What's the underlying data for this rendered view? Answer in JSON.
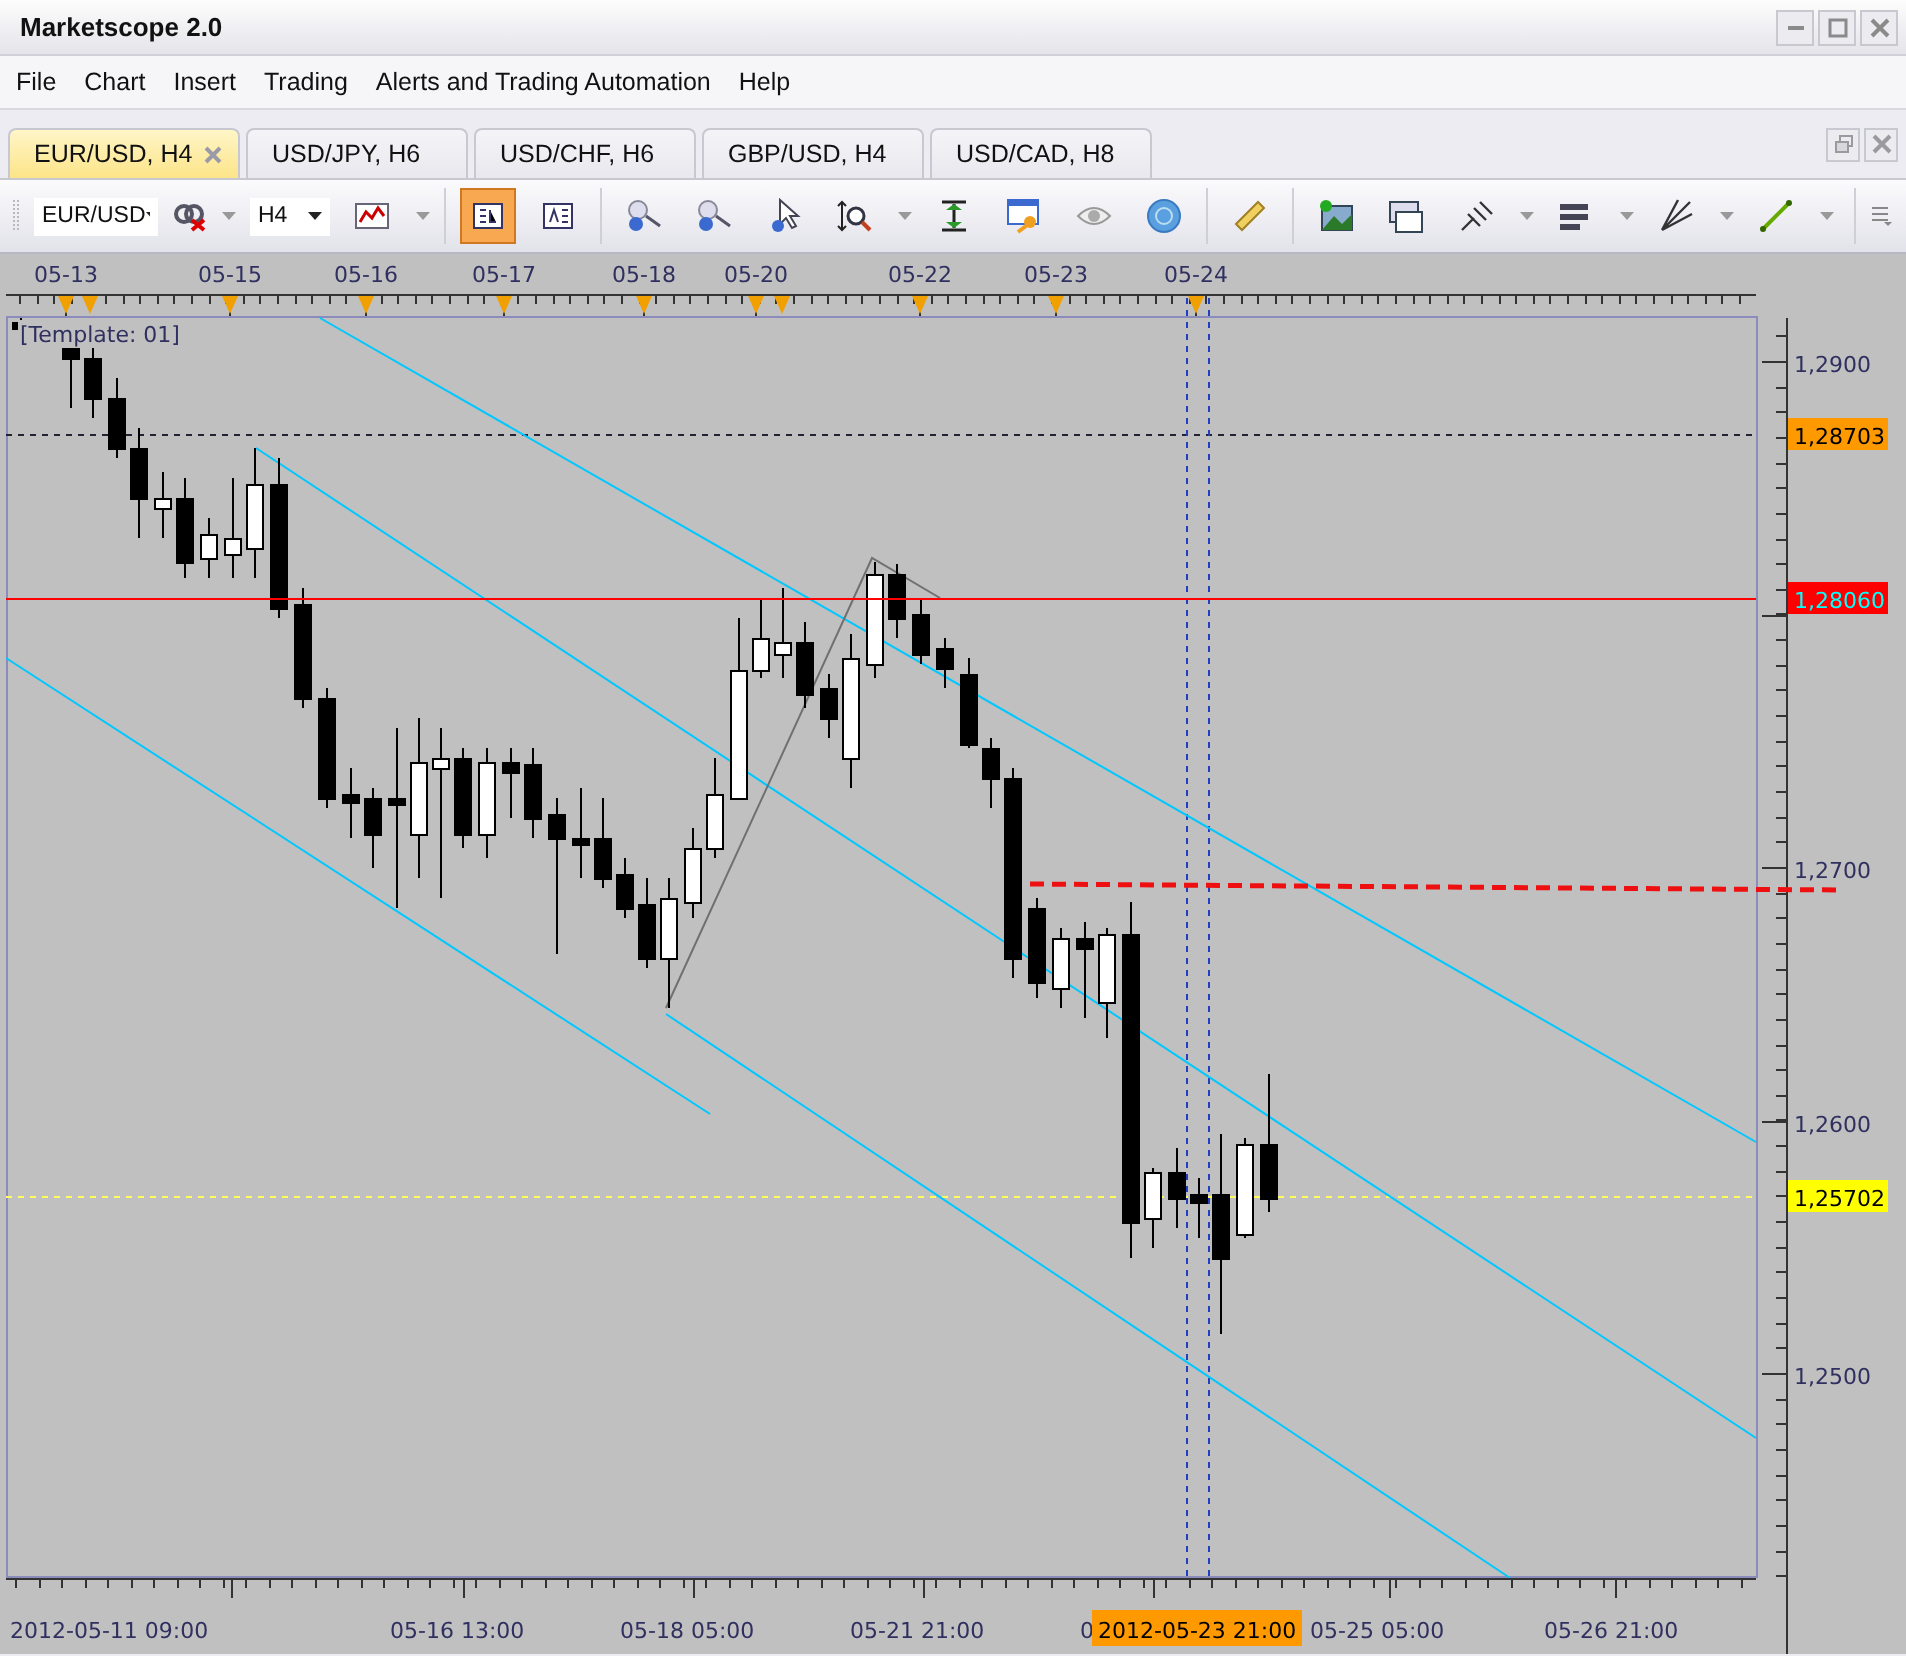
{
  "window": {
    "title": "Marketscope 2.0"
  },
  "menu": [
    "File",
    "Chart",
    "Insert",
    "Trading",
    "Alerts and Trading Automation",
    "Help"
  ],
  "tabs": [
    {
      "label": "EUR/USD, H4",
      "selected": true
    },
    {
      "label": "USD/JPY, H6",
      "selected": false
    },
    {
      "label": "USD/CHF, H6",
      "selected": false
    },
    {
      "label": "GBP/USD, H4",
      "selected": false
    },
    {
      "label": "USD/CAD, H8",
      "selected": false
    }
  ],
  "toolbar": {
    "symbol": "EUR/USD",
    "timeframe": "H4",
    "buttons": [
      {
        "kind": "chart-style",
        "selected": false,
        "dropdown": true
      },
      {
        "kind": "panel",
        "selected": true,
        "dropdown": false
      },
      {
        "kind": "text-panel",
        "selected": false,
        "dropdown": false
      },
      {
        "kind": "zoom-in",
        "selected": false,
        "dropdown": false
      },
      {
        "kind": "zoom-out",
        "selected": false,
        "dropdown": false
      },
      {
        "kind": "pointer",
        "selected": false,
        "dropdown": false
      },
      {
        "kind": "zoom-box",
        "selected": false,
        "dropdown": true
      },
      {
        "kind": "fit",
        "selected": false,
        "dropdown": false
      },
      {
        "kind": "properties",
        "selected": false,
        "dropdown": false
      },
      {
        "kind": "eye",
        "selected": false,
        "dropdown": false
      },
      {
        "kind": "globe",
        "selected": false,
        "dropdown": false
      },
      {
        "kind": "ruler",
        "selected": false,
        "dropdown": false
      },
      {
        "kind": "picture",
        "selected": false,
        "dropdown": false
      },
      {
        "kind": "window",
        "selected": false,
        "dropdown": false
      },
      {
        "kind": "pitchfork",
        "selected": false,
        "dropdown": true
      },
      {
        "kind": "levels",
        "selected": false,
        "dropdown": true
      },
      {
        "kind": "fan",
        "selected": false,
        "dropdown": true
      },
      {
        "kind": "line",
        "selected": false,
        "dropdown": true
      }
    ]
  },
  "chart": {
    "template": "[Template: 01]",
    "date_labels": [
      "05-13",
      "05-15",
      "05-16",
      "05-17",
      "05-18",
      "05-20",
      "05-22",
      "05-23",
      "05-24"
    ],
    "price_labels": [
      "1,2900",
      "1,2700",
      "1,2600",
      "1,2500"
    ],
    "price_markers": [
      {
        "label": "1,28703",
        "color": "#ff9900"
      },
      {
        "label": "1,28060",
        "color": "#ff0000"
      },
      {
        "label": "1,25702",
        "color": "#ffff00"
      }
    ],
    "time_labels": [
      "2012-05-11 09:00",
      "05-16 13:00",
      "05-18 05:00",
      "05-21 21:00",
      "0",
      "05-25 05:00",
      "05-26 21:00"
    ],
    "cursor_time": "2012-05-23 21:00"
  }
}
